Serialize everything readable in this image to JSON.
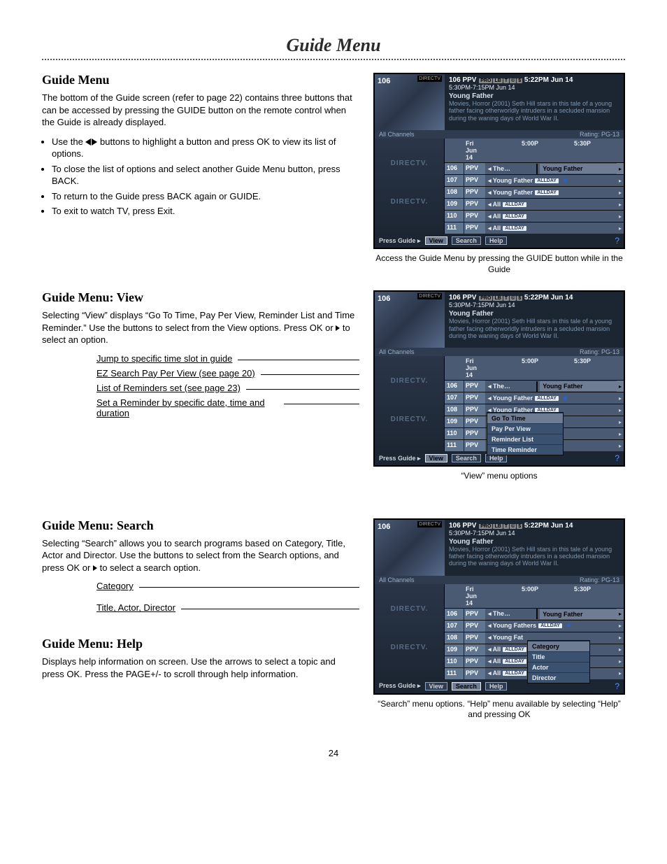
{
  "page_title": "Guide Menu",
  "page_number": "24",
  "s1": {
    "heading": "Guide Menu",
    "para": "The bottom of the Guide screen (refer to page 22) contains three buttons that can be accessed by pressing the GUIDE button on the remote control when the Guide is already displayed.",
    "b1a": "Use the ",
    "b1b": " buttons to highlight a button and press OK to view its list of options.",
    "b2": "To close the list of options and select another Guide Menu button, press BACK.",
    "b3": "To return to the Guide press BACK again or GUIDE.",
    "b4": "To exit to watch TV, press Exit.",
    "caption": "Access the Guide Menu by pressing the GUIDE button while in the Guide"
  },
  "s2": {
    "heading": "Guide Menu: View",
    "para_a": "Selecting “View” displays “Go To Time, Pay Per View, Reminder List and Time Reminder.” Use the        buttons to select from the View options. Press OK or ",
    "para_b": " to select an option.",
    "a1": "Jump to specific time slot in guide",
    "a2": "EZ Search Pay Per View (see page 20)",
    "a3": "List of Reminders set (see page 23)",
    "a4": "Set a Reminder by specific date, time and duration",
    "caption": "“View” menu options"
  },
  "s3": {
    "heading": "Guide Menu: Search",
    "para_a": "Selecting “Search” allows you to search programs based on Category, Title, Actor and Director. Use the        buttons to select from the Search options, and press OK or ",
    "para_b": " to select a search option.",
    "a1": "Category",
    "a2": "Title, Actor, Director"
  },
  "s4": {
    "heading": "Guide Menu: Help",
    "para": "Displays help information on screen. Use the        arrows to select a topic and press OK. Press the PAGE+/- to scroll through help information.",
    "caption": "“Search” menu options. “Help” menu available by selecting “Help” and pressing OK"
  },
  "tv_common": {
    "ch": "106",
    "header_top": "106 PPV ",
    "badges": [
      "PRO",
      "LB",
      "T",
      "©",
      "$"
    ],
    "header_top_tail": " 5:22PM Jun 14",
    "header_sub": "5:30PM-7:15PM Jun 14",
    "prog_title": "Young Father",
    "prog_desc": "Movies, Horror (2001) Seth Hill stars in this tale of a young father facing otherworldly intruders in a secluded mansion during the waning days of World War II.",
    "all_channels": "All Channels",
    "rating": "Rating: PG-13",
    "day": "Fri Jun 14",
    "t1": "5:00P",
    "t2": "5:30P",
    "brand": "DIRECTV",
    "allday": "ALLDAY",
    "footer_txt": "Press Guide",
    "view": "View",
    "search": "Search",
    "help": "Help"
  },
  "tv1_rows": [
    {
      "ch": "106",
      "lbl": "PPV",
      "split": true,
      "p1": "The…",
      "p2": "Young Father"
    },
    {
      "ch": "107",
      "lbl": "PPV",
      "text": "Young Father",
      "allday": true,
      "star": true
    },
    {
      "ch": "108",
      "lbl": "PPV",
      "text": "Young Father",
      "allday": true
    },
    {
      "ch": "109",
      "lbl": "PPV",
      "text": "All",
      "allday": true
    },
    {
      "ch": "110",
      "lbl": "PPV",
      "text": "All",
      "allday": true
    },
    {
      "ch": "111",
      "lbl": "PPV",
      "text": "All",
      "allday": true
    }
  ],
  "tv2_rows": [
    {
      "ch": "106",
      "lbl": "PPV",
      "split": true,
      "p1": "The…",
      "p2": "Young Father"
    },
    {
      "ch": "107",
      "lbl": "PPV",
      "text": "Young Father",
      "allday": true,
      "star": true
    },
    {
      "ch": "108",
      "lbl": "PPV",
      "text": "Young Father",
      "allday": true
    },
    {
      "ch": "109",
      "lbl": "PPV",
      "text": "",
      "allday": false
    },
    {
      "ch": "110",
      "lbl": "PPV",
      "text": "",
      "allday": false
    },
    {
      "ch": "111",
      "lbl": "PPV",
      "text": "",
      "allday": false
    }
  ],
  "tv2_popup": [
    "Go To Time",
    "Pay Per View",
    "Reminder List",
    "Time Reminder"
  ],
  "tv3_rows": [
    {
      "ch": "106",
      "lbl": "PPV",
      "split": true,
      "p1": "The…",
      "p2": "Young Father"
    },
    {
      "ch": "107",
      "lbl": "PPV",
      "text": "Young Fathers",
      "allday": true,
      "star": true
    },
    {
      "ch": "108",
      "lbl": "PPV",
      "text": "Young Fat",
      "allday": false
    },
    {
      "ch": "109",
      "lbl": "PPV",
      "text": "All",
      "allday": true
    },
    {
      "ch": "110",
      "lbl": "PPV",
      "text": "All",
      "allday": true
    },
    {
      "ch": "111",
      "lbl": "PPV",
      "text": "All",
      "allday": true
    }
  ],
  "tv3_popup": [
    "Category",
    "Title",
    "Actor",
    "Director"
  ]
}
